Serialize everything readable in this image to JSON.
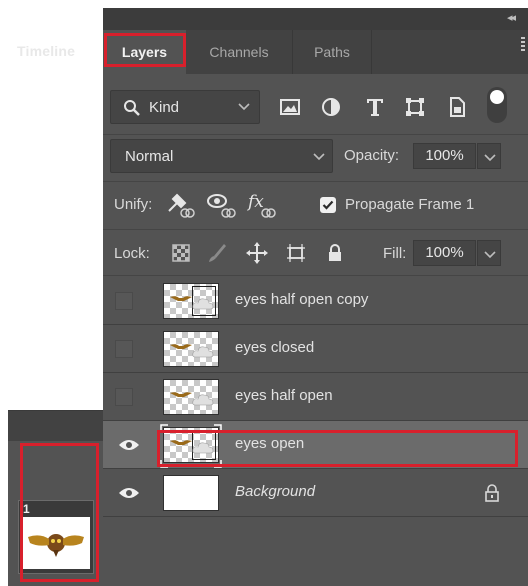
{
  "tabs": {
    "layers": "Layers",
    "channels": "Channels",
    "paths": "Paths"
  },
  "filter": {
    "kind_label": "Kind"
  },
  "blend": {
    "mode": "Normal",
    "opacity_label": "Opacity:",
    "opacity_value": "100%"
  },
  "unify": {
    "label": "Unify:",
    "propagate_label": "Propagate Frame 1",
    "propagate_checked": true
  },
  "lock": {
    "label": "Lock:",
    "fill_label": "Fill:",
    "fill_value": "100%"
  },
  "layers": [
    {
      "name": "eyes half open copy",
      "visible": false,
      "selected": false
    },
    {
      "name": "eyes closed",
      "visible": false,
      "selected": false
    },
    {
      "name": "eyes half open",
      "visible": false,
      "selected": false
    },
    {
      "name": "eyes open",
      "visible": true,
      "selected": true
    },
    {
      "name": "Background",
      "visible": true,
      "selected": false,
      "locked": true
    }
  ],
  "timeline": {
    "tab_label": "Timeline",
    "frame_number": "1"
  },
  "colors": {
    "highlight": "#d8202c",
    "panel_bg": "#535353",
    "selected_row": "#6b6b6b"
  }
}
